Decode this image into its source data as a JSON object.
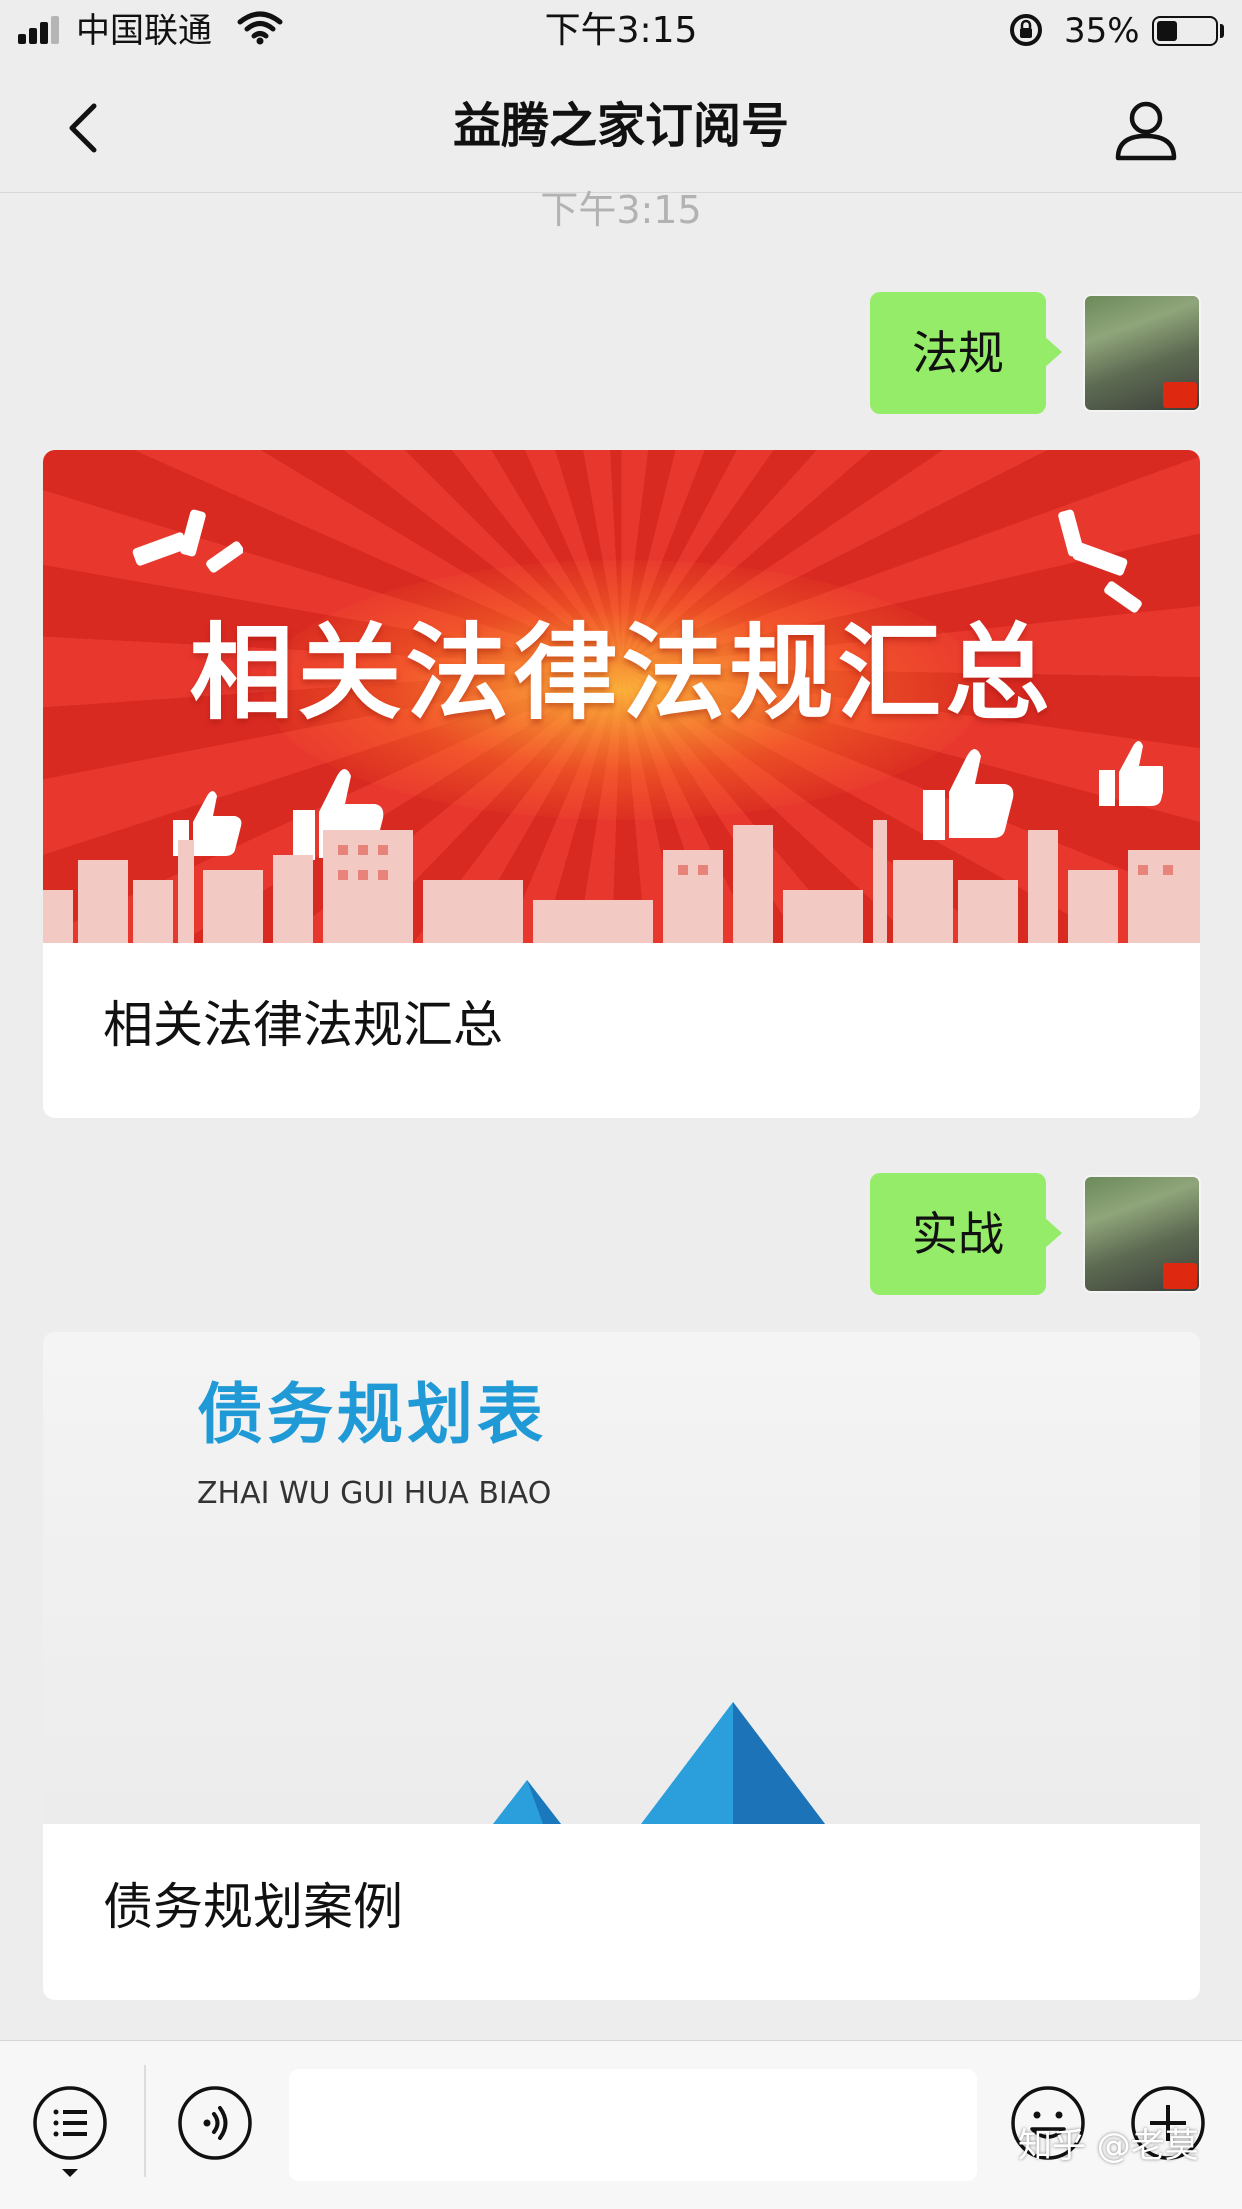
{
  "status_bar": {
    "carrier": "中国联通",
    "time": "下午3:15",
    "battery_percent": "35%",
    "battery_level": 0.35
  },
  "nav": {
    "title": "益腾之家订阅号"
  },
  "chat": {
    "timestamp": "下午3:15",
    "messages": [
      {
        "type": "sent_text",
        "text": "法规"
      },
      {
        "type": "article",
        "banner_text": "相关法律法规汇总",
        "caption": "相关法律法规汇总",
        "banner_color": "#e33a2e"
      },
      {
        "type": "sent_text",
        "text": "实战"
      },
      {
        "type": "article",
        "banner_text": "债务规划表",
        "banner_subtitle": "ZHAI WU GUI HUA BIAO",
        "caption": "债务规划案例",
        "banner_color": "#1f9ad6"
      }
    ]
  },
  "input_bar": {
    "icons": [
      "menu-icon",
      "voice-icon",
      "emoji-icon",
      "plus-icon"
    ]
  },
  "watermark": "知乎 @老莫",
  "colors": {
    "background": "#ededed",
    "sent_bubble": "#95ec69"
  }
}
